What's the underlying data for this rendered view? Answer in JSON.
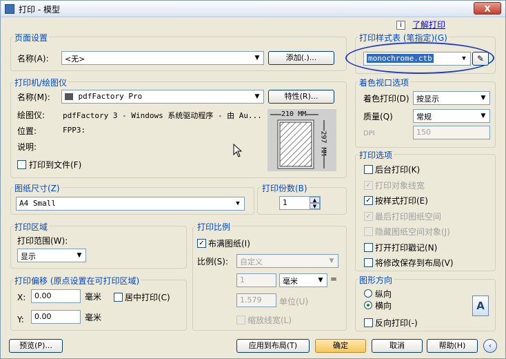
{
  "window": {
    "title": "打印 - 模型",
    "close": "X"
  },
  "help_link": "了解打印",
  "info_icon_text": "i",
  "page_setup": {
    "title": "页面设置",
    "name_label": "名称(A):",
    "name_value": "<无>",
    "add_button": "添加(.)..."
  },
  "printer": {
    "title": "打印机/绘图仪",
    "name_label": "名称(M):",
    "name_value": "pdfFactory Pro",
    "properties_button": "特性(R)...",
    "plotter_label": "绘图仪:",
    "plotter_value": "pdfFactory 3 - Windows 系统驱动程序 - 由 Au...",
    "location_label": "位置:",
    "location_value": "FPP3:",
    "description_label": "说明:",
    "print_to_file_label": "打印到文件(F)",
    "preview_width": "210 MM",
    "preview_height": "297 MM"
  },
  "paper_size": {
    "title": "图纸尺寸(Z)",
    "value": "A4 Small"
  },
  "copies": {
    "title": "打印份数(B)",
    "value": "1"
  },
  "plot_area": {
    "title": "打印区域",
    "range_label": "打印范围(W):",
    "range_value": "显示"
  },
  "plot_offset": {
    "title": "打印偏移 (原点设置在可打印区域)",
    "x_label": "X:",
    "x_value": "0.00",
    "x_unit": "毫米",
    "y_label": "Y:",
    "y_value": "0.00",
    "y_unit": "毫米",
    "center_label": "居中打印(C)"
  },
  "plot_scale": {
    "title": "打印比例",
    "fit_label": "布满图纸(I)",
    "scale_label": "比例(S):",
    "scale_value": "自定义",
    "value1": "1",
    "unit1": "毫米",
    "eq": "=",
    "value2": "1.579",
    "unit2": "单位(U)",
    "lineweights_label": "缩放线宽(L)"
  },
  "style_table": {
    "title": "打印样式表 (笔指定)(G)",
    "value": "monochrome.ctb"
  },
  "shaded_viewport": {
    "title": "着色视口选项",
    "shade_label": "着色打印(D)",
    "shade_value": "按显示",
    "quality_label": "质量(Q)",
    "quality_value": "常规",
    "dpi_label": "DPI",
    "dpi_value": "150"
  },
  "plot_options": {
    "title": "打印选项",
    "items": [
      {
        "label": "后台打印(K)",
        "checked": false,
        "disabled": false
      },
      {
        "label": "打印对象线宽",
        "checked": true,
        "disabled": true
      },
      {
        "label": "按样式打印(E)",
        "checked": true,
        "disabled": false
      },
      {
        "label": "最后打印图纸空间",
        "checked": true,
        "disabled": true
      },
      {
        "label": "隐藏图纸空间对象(J)",
        "checked": false,
        "disabled": true
      },
      {
        "label": "打开打印戳记(N)",
        "checked": false,
        "disabled": false
      },
      {
        "label": "将修改保存到布局(V)",
        "checked": false,
        "disabled": false
      }
    ]
  },
  "orientation": {
    "title": "图形方向",
    "portrait": "纵向",
    "landscape": "横向",
    "upside_down": "反向打印(-)",
    "icon_letter": "A"
  },
  "footer": {
    "preview": "预览(P)...",
    "apply": "应用到布局(T)",
    "ok": "确定",
    "cancel": "取消",
    "help": "帮助(H)"
  },
  "colors": {
    "accent": "#0046d5",
    "highlight": "#316ac5",
    "ellipse": "#1e3cc8"
  }
}
